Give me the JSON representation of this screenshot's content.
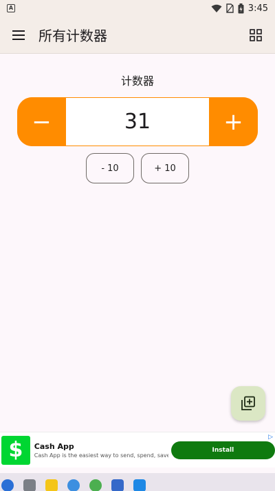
{
  "status_bar": {
    "time": "3:45"
  },
  "app_bar": {
    "title": "所有计数器"
  },
  "counter": {
    "name": "计数器",
    "value": "31",
    "decrement_label": "−",
    "increment_label": "+",
    "minus_ten_label": "- 10",
    "plus_ten_label": "+ 10"
  },
  "ad": {
    "logo_glyph": "$",
    "title": "Cash App",
    "description": "Cash App is the easiest way to send, spend, save,",
    "install_label": "Install",
    "choice_glyph": "▷"
  },
  "colors": {
    "accent": "#ff8c00",
    "fab_background": "#dbe7c4",
    "ad_logo": "#00d632",
    "install_button": "#0f7a0f"
  },
  "icons": [
    "menu-icon",
    "grid-view-icon",
    "add-counter-icon",
    "wifi-icon",
    "battery-icon",
    "sim-icon"
  ]
}
